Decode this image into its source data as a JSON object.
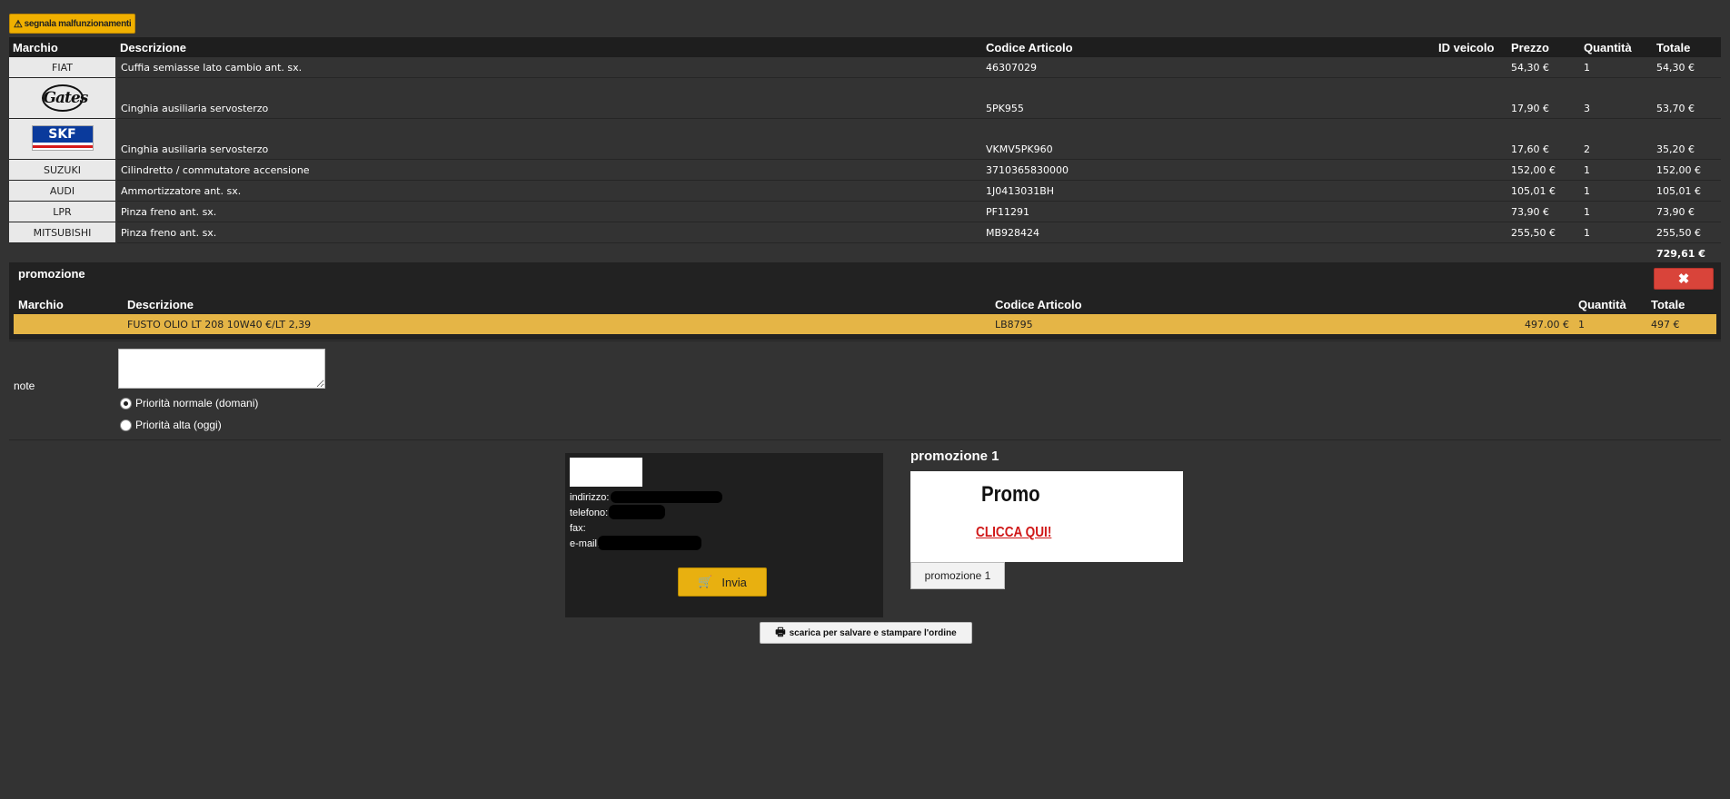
{
  "report_button": {
    "label": "segnala malfunzionamenti"
  },
  "orders": {
    "headers": {
      "marchio": "Marchio",
      "descrizione": "Descrizione",
      "codice": "Codice Articolo",
      "id_veicolo": "ID veicolo",
      "prezzo": "Prezzo",
      "quantita": "Quantità",
      "totale": "Totale"
    },
    "rows": [
      {
        "brand": "FIAT",
        "desc": "Cuffia semiasse lato cambio ant. sx.",
        "code": "46307029",
        "vehicle": "",
        "price": "54,30 €",
        "qty": "1",
        "total": "54,30 €"
      },
      {
        "brand": "Gates",
        "desc": "Cinghia ausiliaria servosterzo",
        "code": "5PK955",
        "vehicle": "",
        "price": "17,90 €",
        "qty": "3",
        "total": "53,70 €"
      },
      {
        "brand": "SKF",
        "desc": "Cinghia ausiliaria servosterzo",
        "code": "VKMV5PK960",
        "vehicle": "",
        "price": "17,60 €",
        "qty": "2",
        "total": "35,20 €"
      },
      {
        "brand": "SUZUKI",
        "desc": "Cilindretto / commutatore accensione",
        "code": "3710365830000",
        "vehicle": "",
        "price": "152,00 €",
        "qty": "1",
        "total": "152,00 €"
      },
      {
        "brand": "AUDI",
        "desc": "Ammortizzatore ant. sx.",
        "code": "1J0413031BH",
        "vehicle": "",
        "price": "105,01 €",
        "qty": "1",
        "total": "105,01 €"
      },
      {
        "brand": "LPR",
        "desc": "Pinza freno ant. sx.",
        "code": "PF11291",
        "vehicle": "",
        "price": "73,90 €",
        "qty": "1",
        "total": "73,90 €"
      },
      {
        "brand": "MITSUBISHI",
        "desc": "Pinza freno ant. sx.",
        "code": "MB928424",
        "vehicle": "",
        "price": "255,50 €",
        "qty": "1",
        "total": "255,50 €"
      }
    ],
    "grand_total": "729,61 €"
  },
  "promotion": {
    "title": "promozione",
    "close_icon": "close-icon",
    "headers": {
      "marchio": "Marchio",
      "descrizione": "Descrizione",
      "codice": "Codice Articolo",
      "quantita": "Quantità",
      "totale": "Totale"
    },
    "row": {
      "brand": "",
      "desc": "FUSTO OLIO LT 208 10W40 €/LT 2,39",
      "code": "LB8795",
      "price": "497.00 €",
      "qty": "1",
      "total": "497 €"
    },
    "row_color": "#e5b546"
  },
  "note": {
    "label": "note",
    "value": "",
    "priority_options": [
      {
        "label": "Priorità normale (domani)",
        "checked": true
      },
      {
        "label": "Priorità alta (oggi)",
        "checked": false
      }
    ]
  },
  "contact": {
    "address_label": "indirizzo:",
    "phone_label": "telefono:",
    "fax_label": "fax:",
    "email_label": "e-mail:",
    "send_label": "Invia",
    "send_icon": "cart-icon"
  },
  "print_button": {
    "label": "scarica per salvare e stampare l'ordine",
    "icon": "printer-icon"
  },
  "promo_panel": {
    "title": "promozione 1",
    "banner_title": "Promo",
    "banner_cta": "CLICCA QUI!",
    "tab_label": "promozione 1"
  },
  "colors": {
    "background": "#333333",
    "accent": "#e8b010",
    "danger": "#d9443a",
    "promo_row": "#e5b546"
  }
}
